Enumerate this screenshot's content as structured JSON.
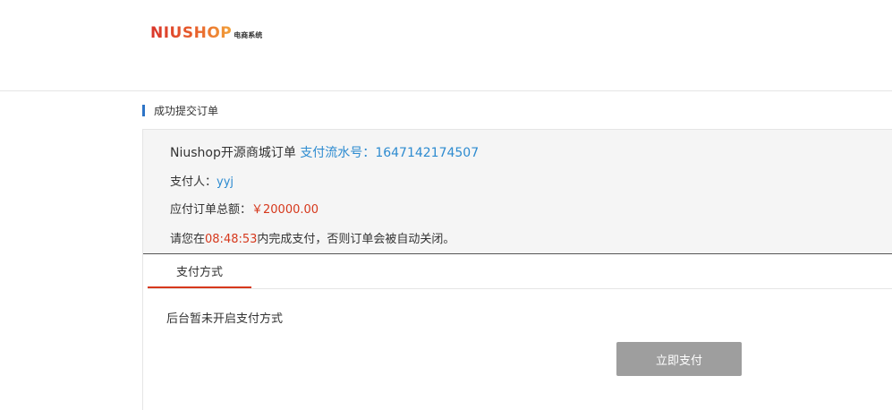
{
  "header": {
    "logo_main": "NIUSHOP",
    "logo_sub": "电商系统"
  },
  "section": {
    "title": "成功提交订单"
  },
  "order": {
    "name": "Niushop开源商城订单",
    "serial_label": "支付流水号：",
    "serial_number": "1647142174507",
    "payer_label": "支付人：",
    "payer_name": "yyj",
    "amount_label": "应付订单总额：",
    "amount_value": "￥20000.00",
    "deadline_prefix": "请您在",
    "deadline_time": "08:48:53",
    "deadline_suffix": "内完成支付，否则订单会被自动关闭。"
  },
  "tabs": [
    {
      "label": "支付方式",
      "active": true
    }
  ],
  "payment": {
    "empty_message": "后台暂未开启支付方式",
    "pay_button": "立即支付"
  },
  "colors": {
    "accent_blue": "#2d8bd0",
    "price_red": "#d6381c",
    "tab_underline": "#d6381c",
    "button_gray": "#9e9e9e"
  }
}
